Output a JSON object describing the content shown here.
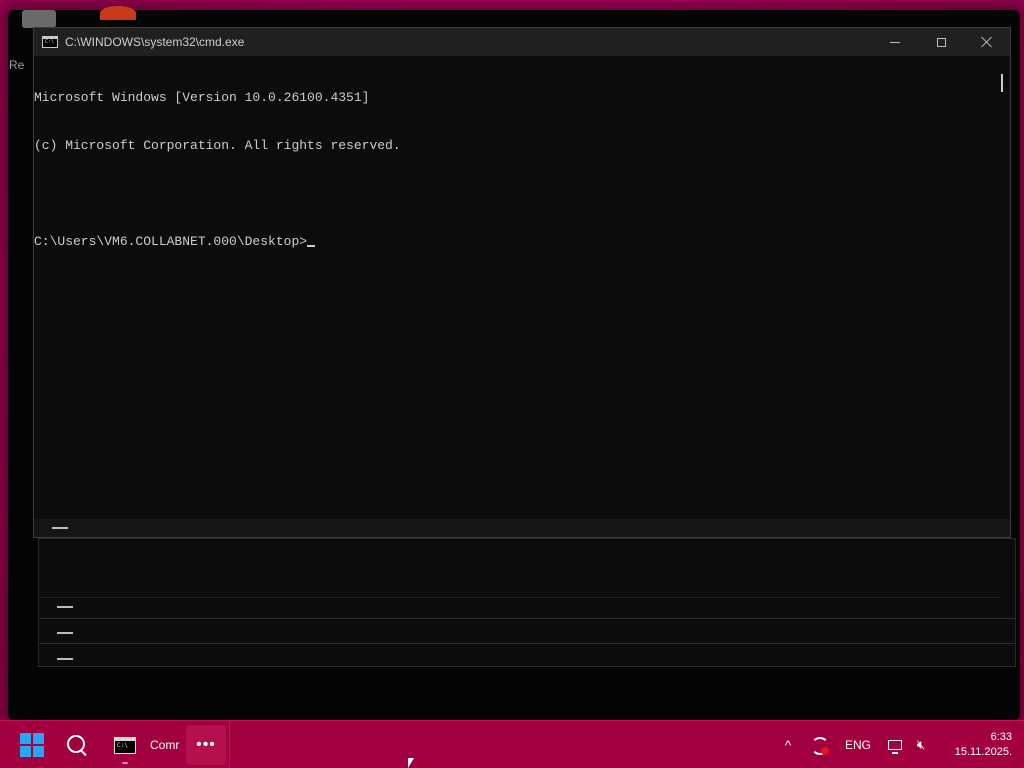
{
  "desktop": {
    "partial_label": "Re"
  },
  "window": {
    "title": "C:\\WINDOWS\\system32\\cmd.exe",
    "icon": "cmd-icon",
    "icon_glyph": "C:\\",
    "controls": {
      "minimize": "minimize-icon",
      "maximize": "maximize-icon",
      "close": "close-icon"
    }
  },
  "console": {
    "lines": [
      "Microsoft Windows [Version 10.0.26100.4351]",
      "(c) Microsoft Corporation. All rights reserved.",
      "",
      "C:\\Users\\VM6.COLLABNET.000\\Desktop>"
    ]
  },
  "taskbar": {
    "start_icon": "windows-start-icon",
    "search_icon": "search-icon",
    "apps": [
      {
        "label": "Comr",
        "icon": "cmd-icon",
        "icon_glyph": "C:\\"
      }
    ],
    "more_icon": "more-icon",
    "more_glyph": "•••",
    "tray": {
      "chevron_glyph": "^",
      "language": "ENG",
      "time": "6:33",
      "date": "15.11.2025."
    }
  },
  "colors": {
    "accent_taskbar": "#a3003f",
    "wallpaper": "#b4005f",
    "console_bg": "#0c0c0c",
    "console_text": "#cccccc",
    "start_logo": "#2aa4f4",
    "alert_dot": "#e81123"
  }
}
